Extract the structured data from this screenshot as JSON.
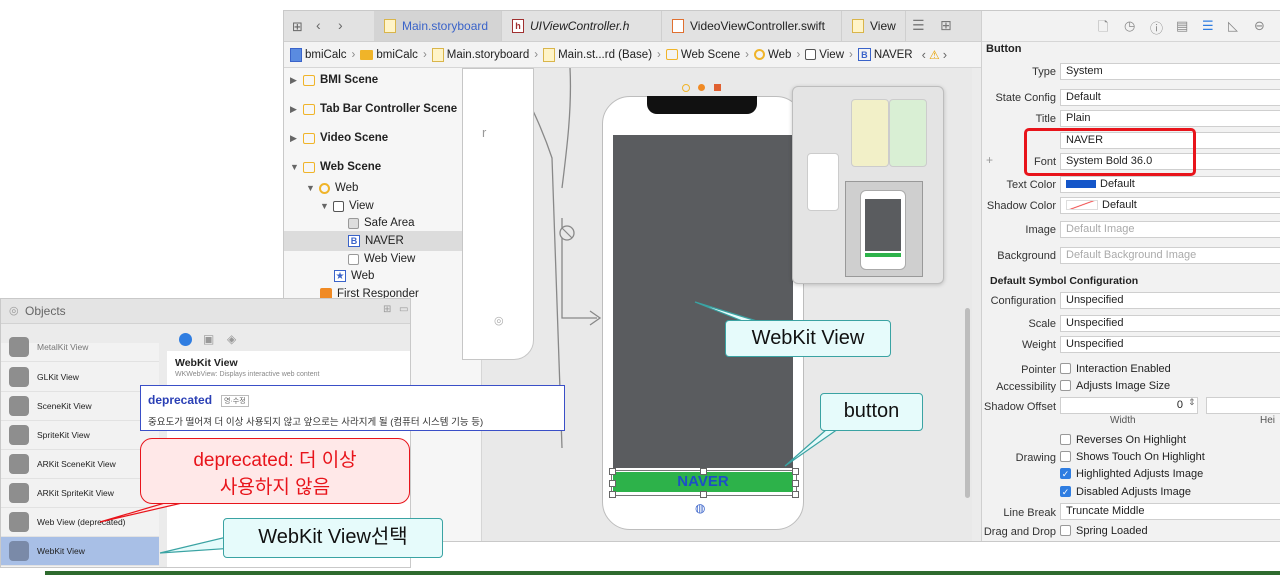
{
  "toolbar": {
    "tabs": [
      {
        "label": "Main.storyboard",
        "icon": "storyboard-file-icon",
        "active": true
      },
      {
        "label": "UIViewController.h",
        "icon": "header-file-icon",
        "active": false
      },
      {
        "label": "VideoViewController.swift",
        "icon": "swift-file-icon",
        "active": false
      },
      {
        "label": "View",
        "icon": "storyboard-file-icon",
        "active": false
      }
    ]
  },
  "breadcrumb": [
    "bmiCalc",
    "bmiCalc",
    "Main.storyboard",
    "Main.st...rd (Base)",
    "Web Scene",
    "Web",
    "View",
    "NAVER"
  ],
  "outline": {
    "scenes": [
      "BMI Scene",
      "Tab Bar Controller Scene",
      "Video Scene",
      "Web Scene"
    ],
    "tree": [
      "Web",
      "View",
      "Safe Area",
      "NAVER",
      "Web View",
      "Web",
      "First Responder"
    ]
  },
  "canvas": {
    "button_title": "NAVER",
    "left_fragment": "r"
  },
  "inspector": {
    "section": "Button",
    "type": {
      "label": "Type",
      "value": "System"
    },
    "state_config": {
      "label": "State Config",
      "value": "Default"
    },
    "title": {
      "label": "Title",
      "value": "Plain"
    },
    "title_text": "NAVER",
    "font": {
      "label": "Font",
      "value": "System Bold 36.0"
    },
    "text_color": {
      "label": "Text Color",
      "value": "Default"
    },
    "shadow_color": {
      "label": "Shadow Color",
      "value": "Default"
    },
    "image": {
      "label": "Image",
      "placeholder": "Default Image"
    },
    "background": {
      "label": "Background",
      "placeholder": "Default Background Image"
    },
    "symbol_section": "Default Symbol Configuration",
    "configuration": {
      "label": "Configuration",
      "value": "Unspecified"
    },
    "scale": {
      "label": "Scale",
      "value": "Unspecified"
    },
    "weight": {
      "label": "Weight",
      "value": "Unspecified"
    },
    "pointer": {
      "label": "Pointer",
      "option": "Interaction Enabled"
    },
    "accessibility": {
      "label": "Accessibility",
      "option": "Adjusts Image Size"
    },
    "shadow_offset": {
      "label": "Shadow Offset",
      "width_value": "0",
      "width_label": "Width",
      "height_label": "Hei"
    },
    "reverses": "Reverses On Highlight",
    "drawing": {
      "label": "Drawing",
      "option": "Shows Touch On Highlight"
    },
    "highlighted": "Highlighted Adjusts Image",
    "disabled": "Disabled Adjusts Image",
    "line_break": {
      "label": "Line Break",
      "value": "Truncate Middle"
    },
    "drag_drop": {
      "label": "Drag and Drop",
      "option": "Spring Loaded"
    }
  },
  "objects_panel": {
    "title": "Objects",
    "items": [
      "MetalKit View",
      "GLKit View",
      "SceneKit View",
      "SpriteKit View",
      "ARKit SceneKit View",
      "ARKit SpriteKit View",
      "Web View (deprecated)",
      "WebKit View"
    ],
    "detail_title": "WebKit View",
    "detail_subtitle": "WKWebView: Displays interactive web content"
  },
  "dictionary": {
    "word": "deprecated",
    "tag": "영·수정",
    "definition": "중요도가 떨어져 더 이상 사용되지 않고 앞으로는 사라지게 될 (컴퓨터 시스템 기능 등)"
  },
  "annotations": {
    "webkit_view": "WebKit View",
    "button": "button",
    "deprecated_line1": "deprecated: 더 이상",
    "deprecated_line2": "사용하지 않음",
    "webkit_select": "WebKit View선택"
  },
  "colors": {
    "highlight_red": "#e8141b",
    "webview_gray": "#5a5c5f",
    "naver_green": "#2db24a",
    "naver_text": "#1d4fc7",
    "callout_border": "#3aa3a3"
  }
}
